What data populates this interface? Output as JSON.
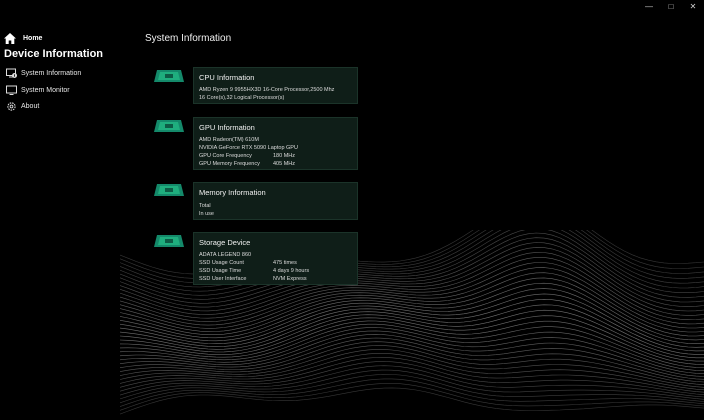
{
  "window": {
    "minimize": "—",
    "maximize": "□",
    "close": "✕"
  },
  "sidebar": {
    "home_label": "Home",
    "section_title": "Device Information",
    "items": [
      {
        "label": "System Information",
        "icon": "system-info-icon"
      },
      {
        "label": "System Monitor",
        "icon": "monitor-icon"
      },
      {
        "label": "About",
        "icon": "gear-icon"
      }
    ]
  },
  "page": {
    "title": "System Information"
  },
  "cards": {
    "cpu": {
      "title": "CPU Information",
      "model": "AMD Ryzen 9 9955HX3D 16-Core Processor,2500 Mhz",
      "cores": "16 Core(s),32 Logical Processor(s)"
    },
    "gpu": {
      "title": "GPU Information",
      "gpu1": "AMD Radeon(TM) 610M",
      "gpu2": "NVIDIA GeForce RTX 5090 Laptop GPU",
      "core_freq_label": "GPU Core Frequency",
      "core_freq_value": "180 MHz",
      "mem_freq_label": "GPU Memory Frequency",
      "mem_freq_value": "405 MHz"
    },
    "memory": {
      "title": "Memory Information",
      "total_label": "Total",
      "in_use_label": "In use"
    },
    "storage": {
      "title": "Storage Device",
      "device": "ADATA LEGEND 860",
      "usage_count_label": "SSD Usage Count",
      "usage_count_value": "475 times",
      "usage_time_label": "SSD Usage Time",
      "usage_time_value": "4 days 9 hours",
      "interface_label": "SSD User Interface",
      "interface_value": "NVM Express"
    }
  },
  "colors": {
    "accent": "#1fae7e",
    "card_bg": "#0f1e18",
    "card_border": "#1b3329",
    "background": "#000000"
  }
}
